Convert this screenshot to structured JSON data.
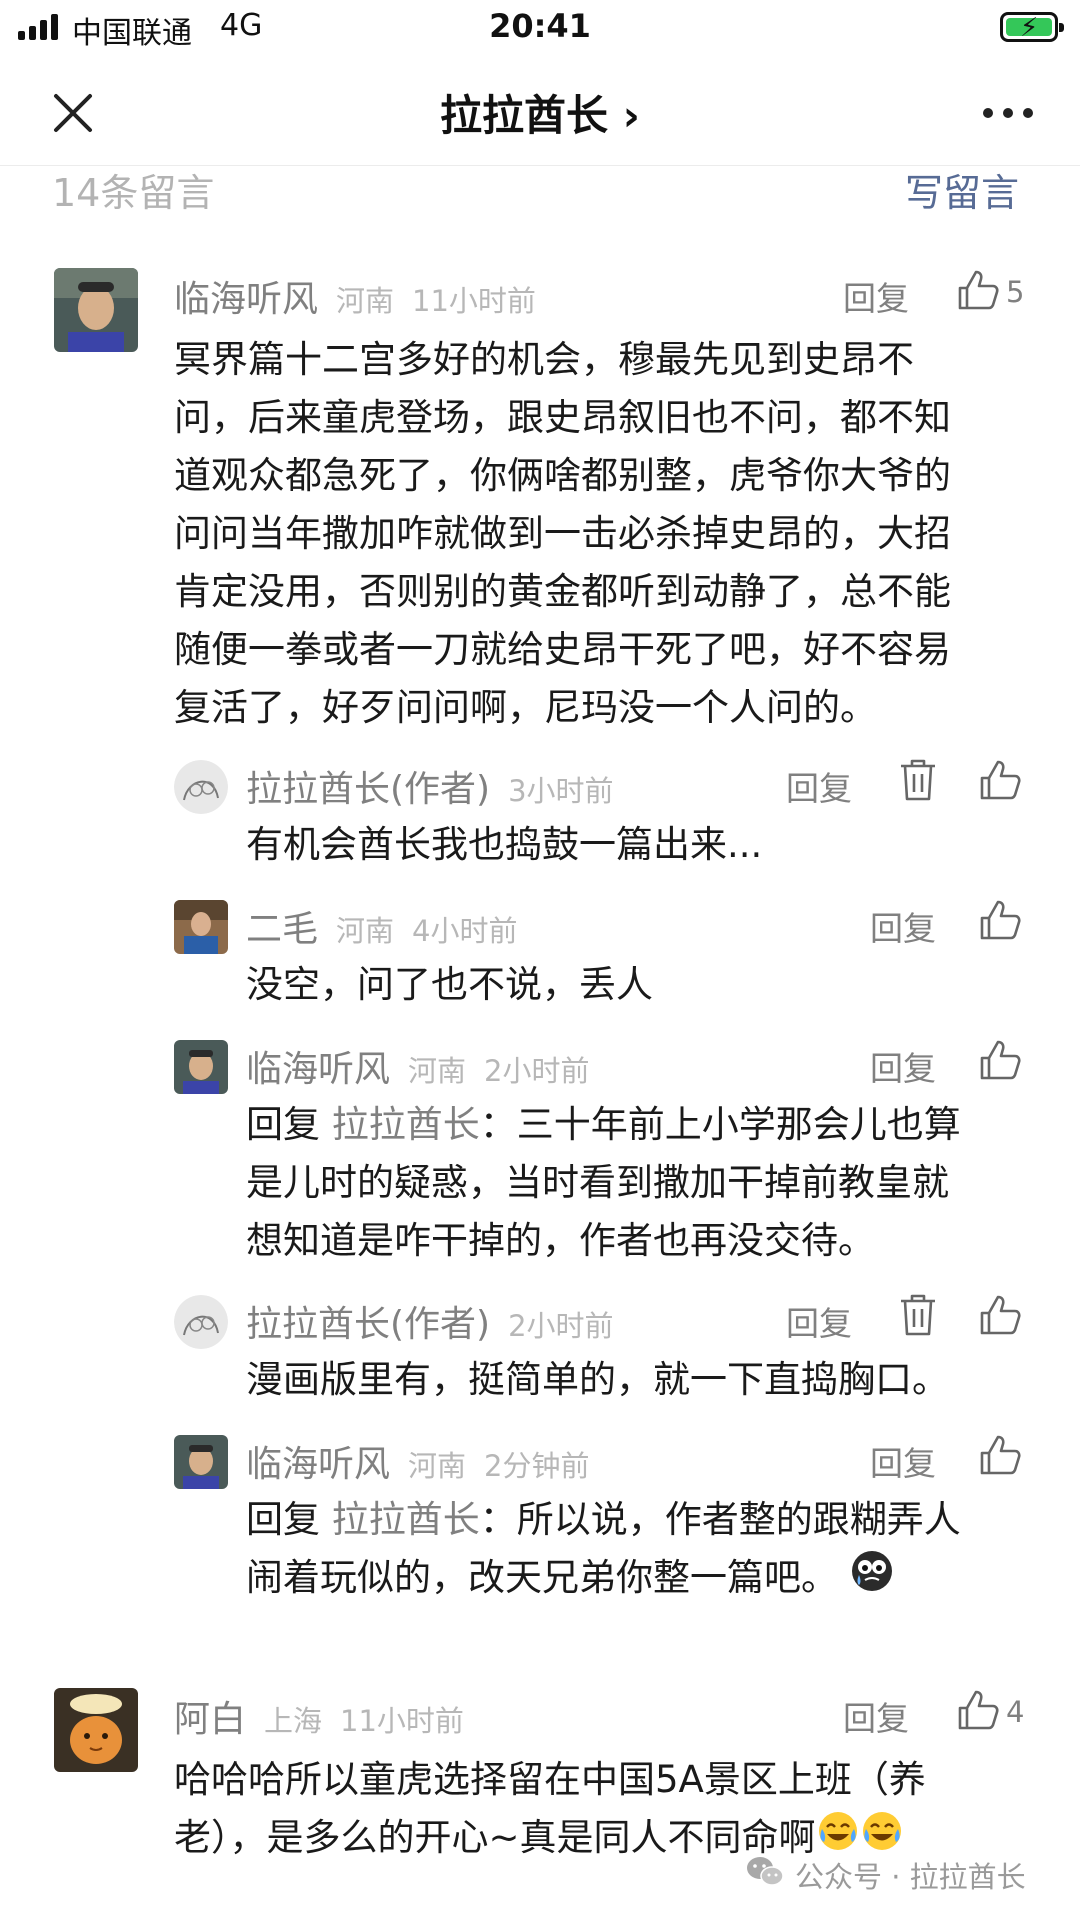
{
  "status_bar": {
    "carrier": "中国联通",
    "network": "4G",
    "time": "20:41",
    "battery_state": "charging"
  },
  "nav": {
    "title": "拉拉酋长 ›",
    "close_icon": "close-icon",
    "more_icon": "more-dots-icon"
  },
  "comments_header": {
    "count_label": "14条留言",
    "write_label": "写留言"
  },
  "comments": [
    {
      "nickname": "临海听风",
      "region": "河南",
      "time": "11小时前",
      "reply_label": "回复",
      "likes": "5",
      "lines": [
        "冥界篇十二宫多好的机会，穆最先见到史昂不",
        "问，后来童虎登场，跟史昂叙旧也不问，都不知",
        "道观众都急死了，你俩啥都别整，虎爷你大爷的",
        "问问当年撒加咋就做到一击必杀掉史昂的，大招",
        "肯定没用，否则别的黄金都听到动静了，总不能",
        "随便一拳或者一刀就给史昂干死了吧，好不容易",
        "复活了，好歹问问啊，尼玛没一个人问的。"
      ],
      "replies": [
        {
          "nickname": "拉拉酋长(作者)",
          "time": "3小时前",
          "reply_label": "回复",
          "lines": [
            "有机会酋长我也捣鼓一篇出来..."
          ]
        },
        {
          "nickname": "二毛",
          "region": "河南",
          "time": "4小时前",
          "reply_label": "回复",
          "lines": [
            "没空，问了也不说，丢人"
          ]
        },
        {
          "nickname": "临海听风",
          "region": "河南",
          "time": "2小时前",
          "reply_label": "回复",
          "prefix": "回复 ",
          "target": "拉拉酋长",
          "first_line_rest": "：三十年前上小学那会儿也算",
          "lines": [
            "是儿时的疑惑，当时看到撒加干掉前教皇就",
            "想知道是咋干掉的，作者也再没交待。"
          ]
        },
        {
          "nickname": "拉拉酋长(作者)",
          "time": "2小时前",
          "reply_label": "回复",
          "lines": [
            "漫画版里有，挺简单的，就一下直捣胸口。"
          ]
        },
        {
          "nickname": "临海听风",
          "region": "河南",
          "time": "2分钟前",
          "reply_label": "回复",
          "prefix": "回复 ",
          "target": "拉拉酋长",
          "first_line_rest": "：所以说，作者整的跟糊弄人",
          "lines": [
            "闹着玩似的，改天兄弟你整一篇吧。"
          ],
          "emoji": "crying-face-emoji"
        }
      ]
    },
    {
      "nickname": "阿白",
      "region": "上海",
      "time": "11小时前",
      "reply_label": "回复",
      "likes": "4",
      "lines": [
        "哈哈哈所以童虎选择留在中国5A景区上班（养",
        "老），是多么的开心~真是同人不同命啊"
      ],
      "emoji": "tears-of-joy-emoji"
    }
  ],
  "watermark": {
    "text": "公众号 · 拉拉酋长",
    "icon": "wechat-icon"
  }
}
